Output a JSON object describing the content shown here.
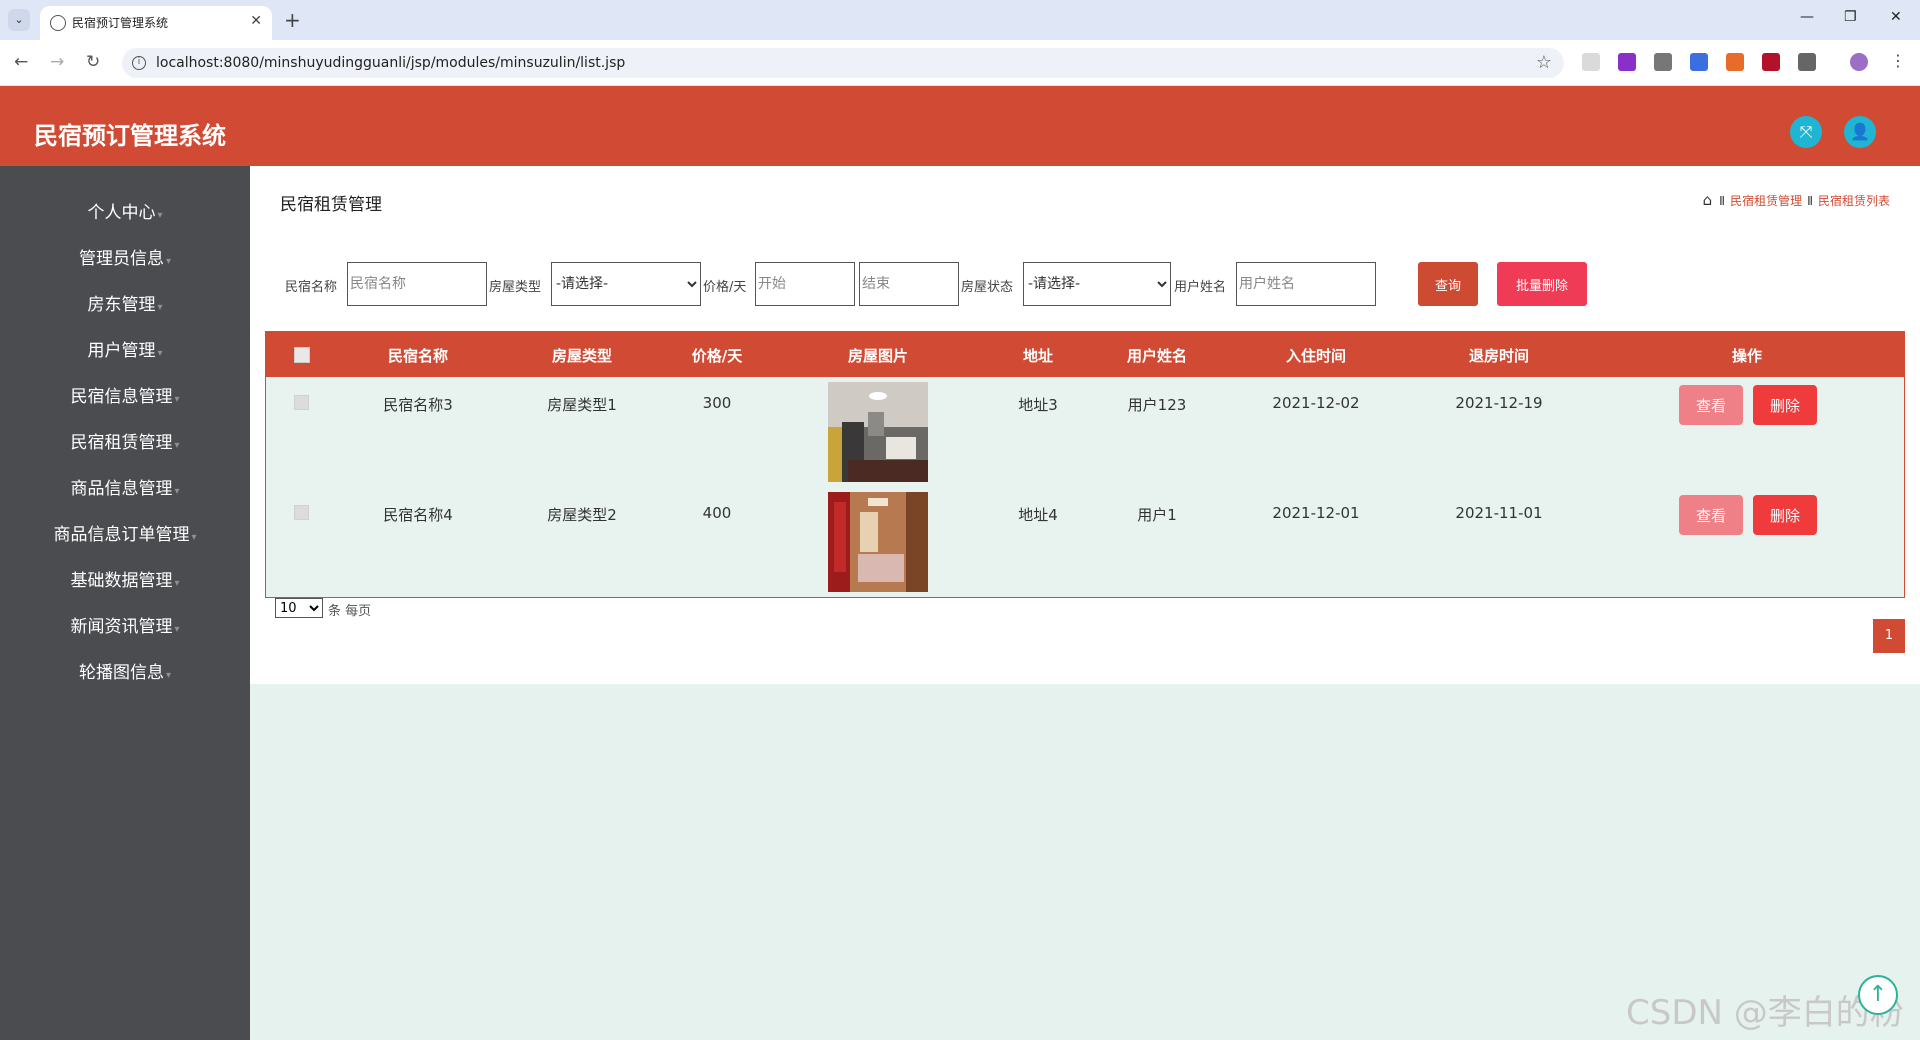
{
  "browser": {
    "tab_title": "民宿预订管理系统",
    "url": "localhost:8080/minshuyudingguanli/jsp/modules/minsuzulin/list.jsp"
  },
  "app": {
    "title": "民宿预订管理系统"
  },
  "sidebar": {
    "items": [
      {
        "label": "个人中心"
      },
      {
        "label": "管理员信息"
      },
      {
        "label": "房东管理"
      },
      {
        "label": "用户管理"
      },
      {
        "label": "民宿信息管理"
      },
      {
        "label": "民宿租赁管理"
      },
      {
        "label": "商品信息管理"
      },
      {
        "label": "商品信息订单管理"
      },
      {
        "label": "基础数据管理"
      },
      {
        "label": "新闻资讯管理"
      },
      {
        "label": "轮播图信息"
      }
    ]
  },
  "page": {
    "title": "民宿租赁管理",
    "breadcrumb": [
      "民宿租赁管理",
      "民宿租赁列表"
    ]
  },
  "filters": {
    "name_label": "民宿名称",
    "name_placeholder": "民宿名称",
    "type_label": "房屋类型",
    "type_selected": "-请选择-",
    "price_label": "价格/天",
    "price_start_placeholder": "开始",
    "price_end_placeholder": "结束",
    "status_label": "房屋状态",
    "status_selected": "-请选择-",
    "username_label": "用户姓名",
    "username_placeholder": "用户姓名",
    "query_label": "查询",
    "batch_delete_label": "批量删除"
  },
  "table": {
    "headers": [
      "民宿名称",
      "房屋类型",
      "价格/天",
      "房屋图片",
      "地址",
      "用户姓名",
      "入住时间",
      "退房时间",
      "操作"
    ],
    "rows": [
      {
        "name": "民宿名称3",
        "type": "房屋类型1",
        "price": "300",
        "address": "地址3",
        "user": "用户123",
        "checkin": "2021-12-02",
        "checkout": "2021-12-19",
        "view_label": "查看",
        "delete_label": "删除"
      },
      {
        "name": "民宿名称4",
        "type": "房屋类型2",
        "price": "400",
        "address": "地址4",
        "user": "用户1",
        "checkin": "2021-12-01",
        "checkout": "2021-11-01",
        "view_label": "查看",
        "delete_label": "删除"
      }
    ]
  },
  "pagination": {
    "page_size": "10",
    "page_size_label": "条 每页",
    "current_page": "1"
  },
  "watermark": "CSDN @李白的粉",
  "colors": {
    "primary": "#d14b34",
    "sidebar": "#4a4c50",
    "background": "#e6f2ee",
    "delete": "#f03b3d",
    "view": "#f08088",
    "header_icon": "#1fb5d3"
  }
}
